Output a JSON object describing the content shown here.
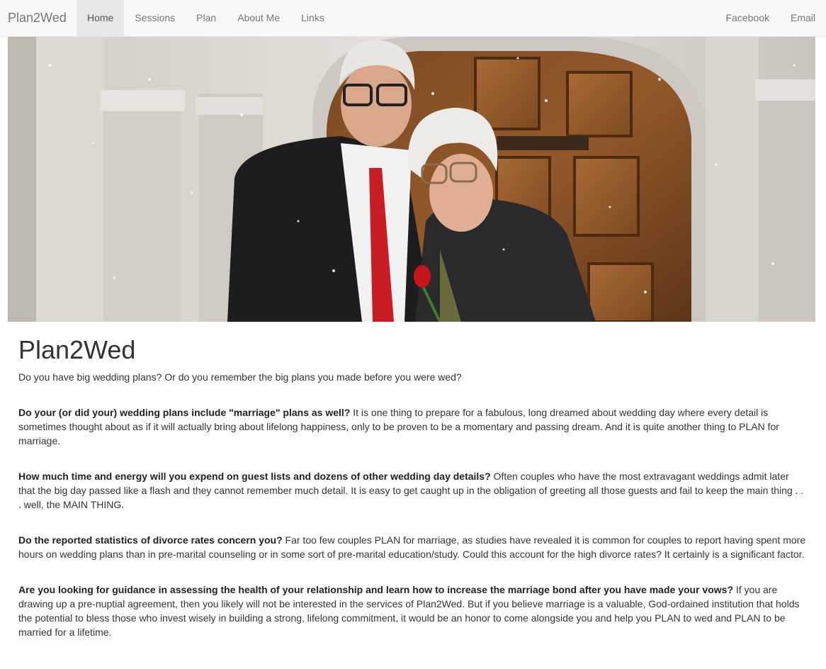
{
  "nav": {
    "brand": "Plan2Wed",
    "left_items": [
      {
        "label": "Home",
        "active": true
      },
      {
        "label": "Sessions",
        "active": false
      },
      {
        "label": "Plan",
        "active": false
      },
      {
        "label": "About Me",
        "active": false
      },
      {
        "label": "Links",
        "active": false
      }
    ],
    "right_items": [
      {
        "label": "Facebook"
      },
      {
        "label": "Email"
      }
    ]
  },
  "hero": {
    "image": "elderly-couple-at-church-door-photo"
  },
  "main": {
    "title": "Plan2Wed",
    "intro": "Do you have big wedding plans? Or do you remember the big plans you made before you were wed?",
    "sections": [
      {
        "question": "Do your (or did your) wedding plans include \"marriage\" plans as well?",
        "text": " It is one thing to prepare for a fabulous, long dreamed about wedding day where every detail is sometimes thought about as if it will actually bring about lifelong happiness, only to be proven to be a momentary and passing dream. And it is quite another thing to PLAN for marriage."
      },
      {
        "question": "How much time and energy will you expend on guest lists and dozens of other wedding day details?",
        "text": " Often couples who have the most extravagant weddings admit later that the big day passed like a flash and they cannot remember much detail. It is easy to get caught up in the obligation of greeting all those guests and fail to keep the main thing . . . well, the MAIN THING."
      },
      {
        "question": "Do the reported statistics of divorce rates concern you?",
        "text": " Far too few couples PLAN for marriage, as studies have revealed it is common for couples to report having spent more hours on wedding plans than in pre-marital counseling or in some sort of pre-marital education/study. Could this account for the high divorce rates? It certainly is a significant factor."
      },
      {
        "question": "Are you looking for guidance in assessing the health of your relationship and learn how to increase the marriage bond after you have made your vows?",
        "text": " If you are drawing up a pre-nuptial agreement, then you likely will not be interested in the services of Plan2Wed. But if you believe marriage is a valuable, God-ordained institution that holds the potential to bless those who invest wisely in building a strong, lifelong commitment, it would be an honor to come alongside you and help you PLAN to wed and PLAN to be married for a lifetime."
      }
    ]
  }
}
